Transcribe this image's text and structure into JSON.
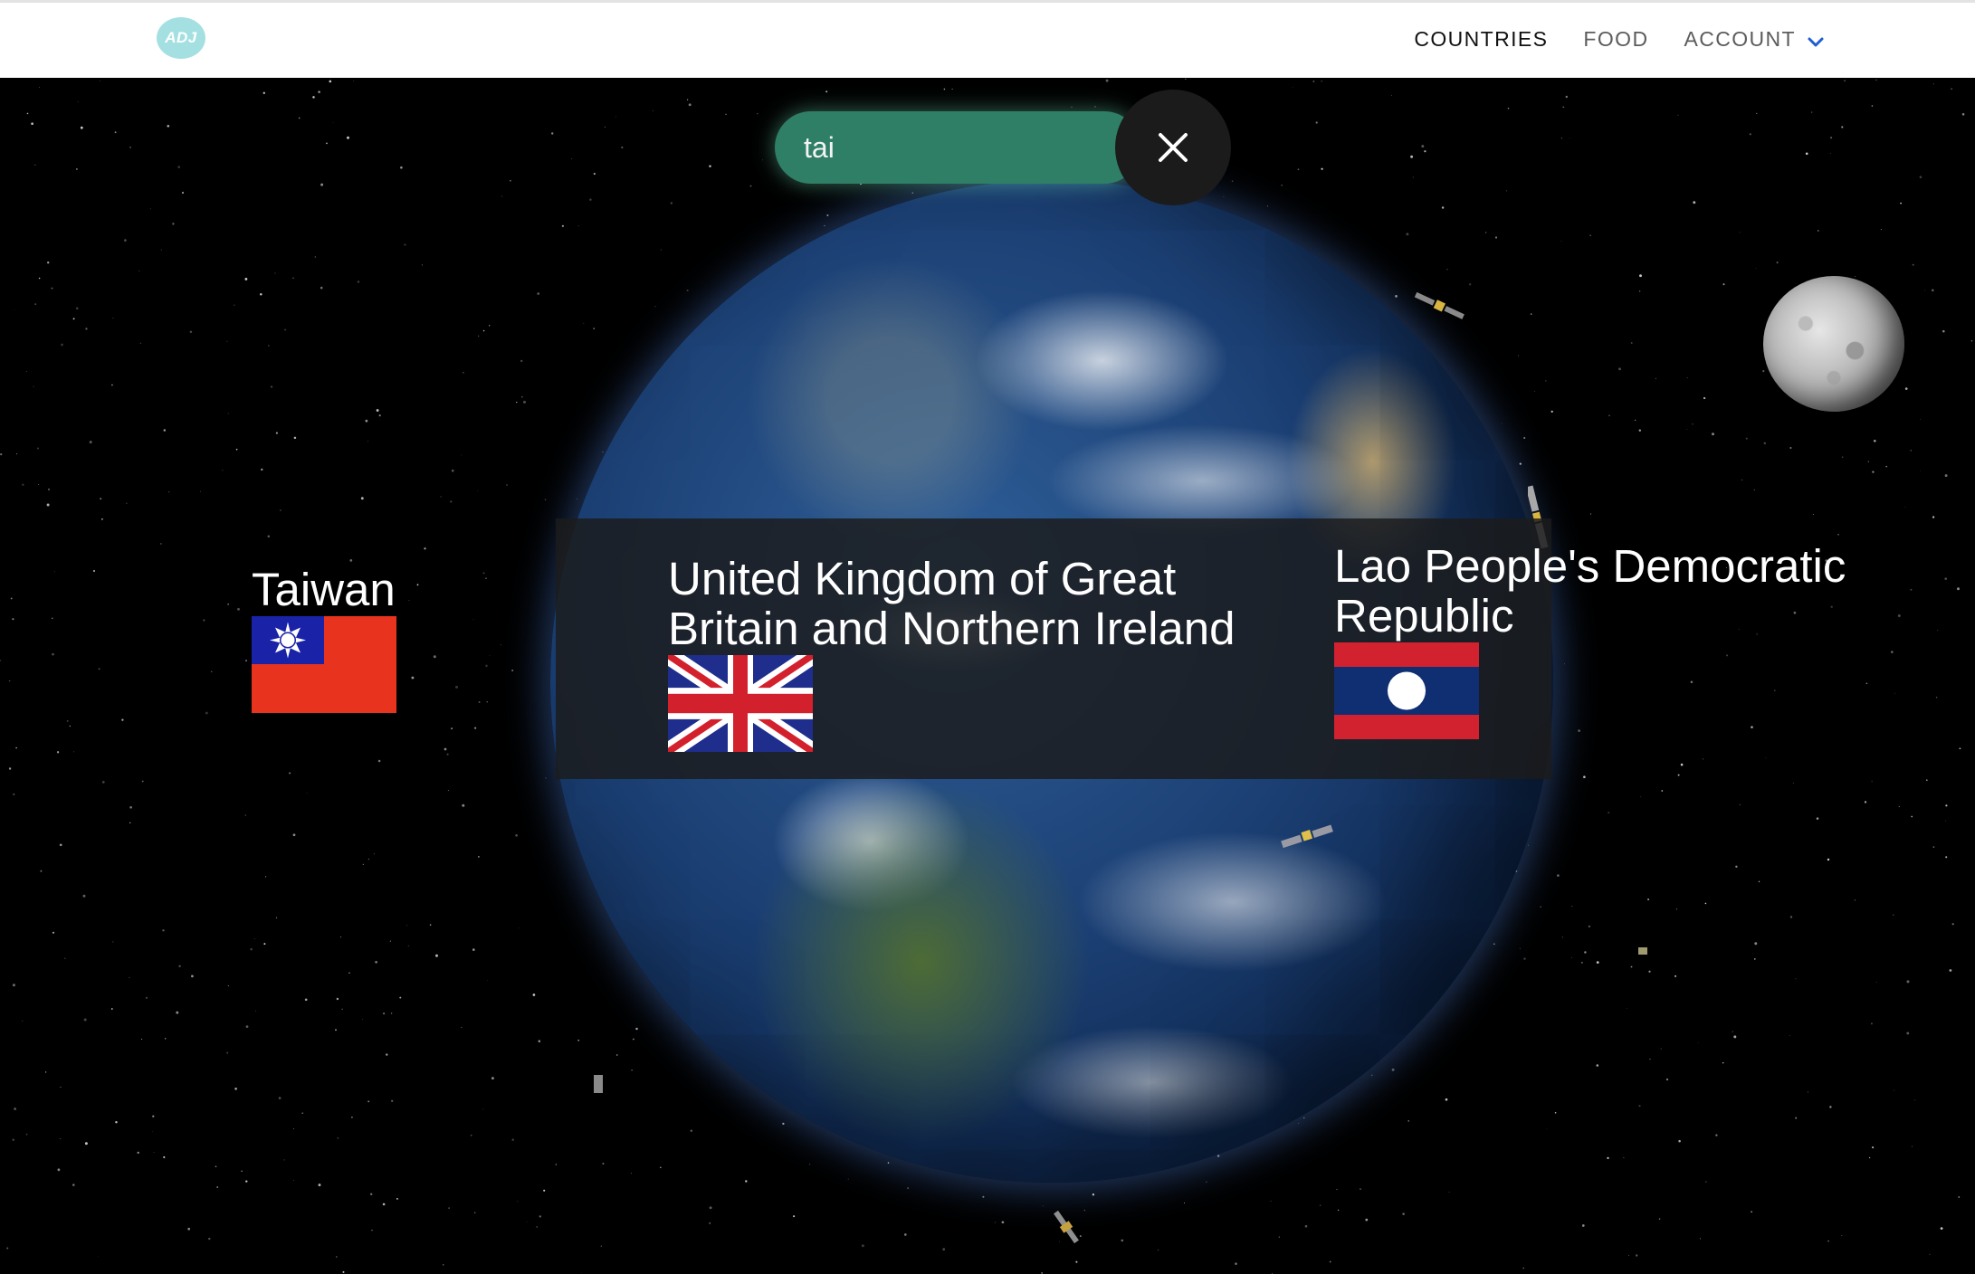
{
  "app": {
    "logo_text": "ADJ",
    "nav": {
      "countries": "COUNTRIES",
      "food": "FOOD",
      "account": "ACCOUNT"
    }
  },
  "search": {
    "value": "tai"
  },
  "results": [
    {
      "name": "Taiwan",
      "flag": "taiwan-flag-icon"
    },
    {
      "name": "United Kingdom of Great Britain and Northern Ireland",
      "flag": "uk-flag-icon"
    },
    {
      "name": "Lao People's Democratic Republic",
      "flag": "laos-flag-icon"
    }
  ],
  "colors": {
    "logo": "#a4e0e2",
    "search_bg": "#2f7f67",
    "account_chevron": "#1f5fd1",
    "taiwan_red": "#e8341f",
    "taiwan_blue": "#1a22a8",
    "uk_blue": "#1f2e8c",
    "uk_red": "#d3202d",
    "laos_red": "#d3222f",
    "laos_blue": "#102e72"
  }
}
